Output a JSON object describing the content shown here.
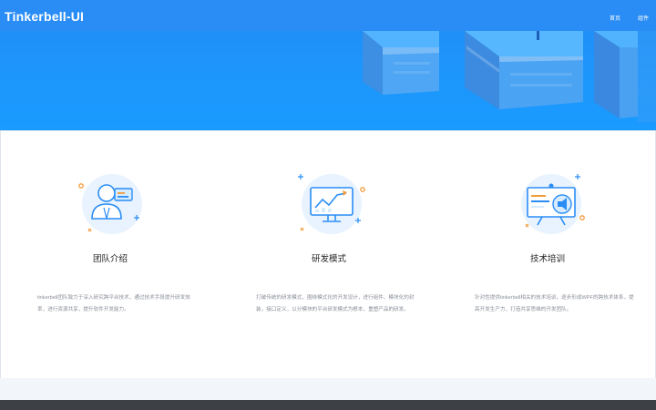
{
  "brand": {
    "logo_text": "Tinkerbell-UI"
  },
  "nav": {
    "items": [
      {
        "label": "首页"
      },
      {
        "label": "组件"
      }
    ]
  },
  "features": [
    {
      "title": "团队介绍",
      "description": "tinkerbell团队致力于深入研究跨平台技术，通过技术手段提升研发效率，进行资源共享，提升软件开发能力。",
      "icon": "team-presentation-icon"
    },
    {
      "title": "研发模式",
      "description": "打破传统的研发模式，围绕模式化的开发设计，进行组件、模块化的封装，接口定义，以分模块的平台研发模式为根本，重塑产品的研发。",
      "icon": "chart-monitor-icon"
    },
    {
      "title": "技术培训",
      "description": "针对性提供tinkerbell相关的技术培训，逐步形成WPF的跨技术体系，提高开发生产力，打造共享思维的开发团队。",
      "icon": "training-board-icon"
    }
  ],
  "colors": {
    "primary": "#2a8df5",
    "hero_gradient_end": "#1a9bff",
    "accent_orange": "#f29b3a",
    "footer": "#3d4146"
  }
}
